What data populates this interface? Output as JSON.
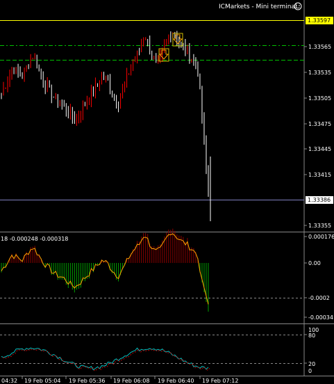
{
  "window": {
    "title": "ICMarkets - Mini terminal",
    "smiley_icon": "smiley-face-icon"
  },
  "colors": {
    "background": "#000000",
    "bull_candle": "#ff0000",
    "bear_candle": "#ffffff",
    "resistance_line": "#ffff00",
    "level_lines": "#00c000",
    "current_price_line": "#7f7fbf",
    "macd_positive": "#8b0000",
    "macd_negative": "#00a000",
    "signal_line": "#ffa500",
    "stoch_main": "#00c0c0",
    "stoch_signal": "#c00000"
  },
  "price_panel": {
    "price_labels": [
      "1.33535",
      "1.33505",
      "1.33475",
      "1.33445",
      "1.33415",
      "1.33355"
    ],
    "resistance_price": "1.33597",
    "level_upper": "1.33565",
    "current_price": "1.33386",
    "signal_markers": [
      "arrow-down-icon",
      "arrow-down-icon"
    ]
  },
  "macd_panel": {
    "header": "18 -0.000248 -0.000318",
    "scale_labels": [
      "0.000176",
      "0.00",
      "-0.0002",
      "-0.00034"
    ]
  },
  "stoch_panel": {
    "scale_labels": [
      "100",
      "80",
      "20",
      "0"
    ]
  },
  "time_axis": {
    "labels": [
      "04:32",
      "19 Feb 05:04",
      "19 Feb 05:36",
      "19 Feb 06:08",
      "19 Feb 06:40",
      "19 Feb 07:12"
    ]
  },
  "chart_data": {
    "type": "candlestick",
    "symbol_terminal": "ICMarkets - Mini terminal",
    "approx_close_series": [
      1.3351,
      1.33525,
      1.3354,
      1.33535,
      1.3353,
      1.33545,
      1.33555,
      1.3354,
      1.33525,
      1.33515,
      1.33505,
      1.335,
      1.33495,
      1.33485,
      1.3348,
      1.3349,
      1.335,
      1.3351,
      1.3352,
      1.3353,
      1.33525,
      1.3351,
      1.335,
      1.33515,
      1.33535,
      1.3355,
      1.3356,
      1.3358,
      1.3356,
      1.33545,
      1.3355,
      1.3357,
      1.33585,
      1.33575,
      1.33565,
      1.3356,
      1.3355,
      1.3354,
      1.3347,
      1.3339
    ],
    "indicators": [
      {
        "name": "MACD",
        "values_shown": [
          -0.000248,
          -0.000318
        ]
      },
      {
        "name": "Stochastic",
        "levels": [
          80,
          20
        ]
      }
    ]
  }
}
